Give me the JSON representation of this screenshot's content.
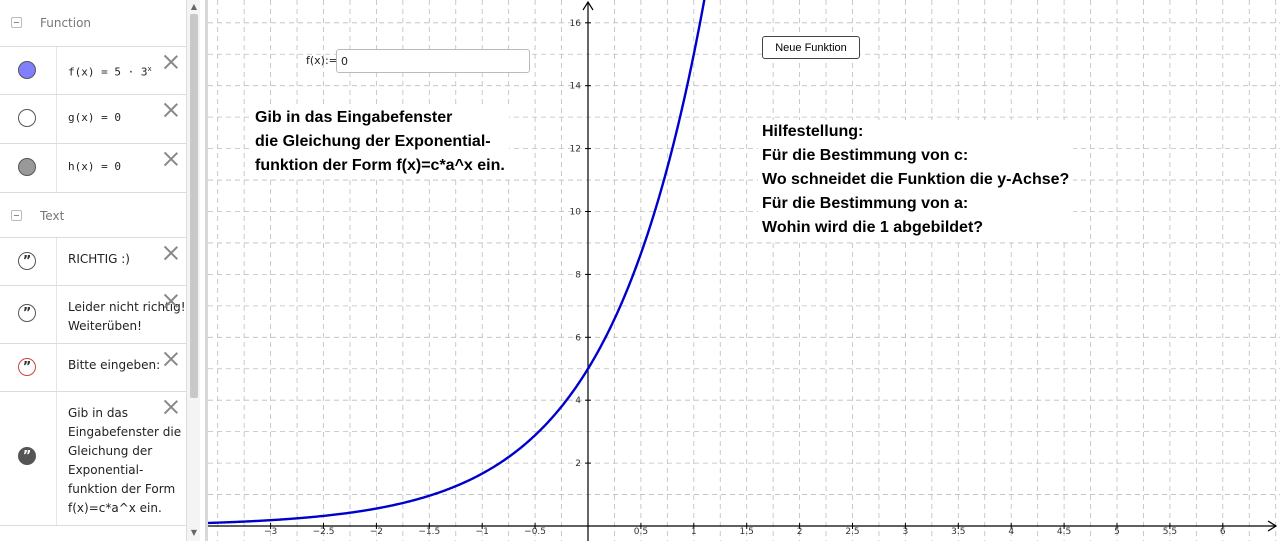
{
  "algebra": {
    "groups": [
      {
        "title": "Function"
      },
      {
        "title": "Text"
      }
    ],
    "functions": [
      {
        "name": "f(x)",
        "expr": "= 5 · 3",
        "exp": "x",
        "color": "#8080ff"
      },
      {
        "name": "g(x)",
        "expr": "= 0",
        "color": "#ffffff"
      },
      {
        "name": "h(x)",
        "expr": "= 0",
        "color": "#999999"
      }
    ],
    "texts": [
      {
        "lines": [
          "RICHTIG :)"
        ]
      },
      {
        "lines": [
          "Leider nicht richtig!",
          "Weiterüben!"
        ]
      },
      {
        "lines": [
          "Bitte eingeben:"
        ]
      },
      {
        "lines": [
          "Gib in das",
          "Eingabefenster die",
          "Gleichung der",
          "Exponential-",
          "funktion der Form",
          "f(x)=c*a^x ein."
        ]
      }
    ]
  },
  "input_box": {
    "label": "f(x):=",
    "value": "0"
  },
  "button": {
    "label": "Neue Funktion"
  },
  "instruction": {
    "lines": [
      "Gib in das Eingabefenster",
      "die Gleichung der Exponential-",
      "funktion der Form f(x)=c*a^x ein."
    ]
  },
  "hint": {
    "lines": [
      "Hilfestellung:",
      "Für die Bestimmung von c:",
      "Wo schneidet die Funktion die y-Achse?",
      "Für die Bestimmung von a:",
      "Wohin wird die 1 abgebildet?"
    ]
  },
  "chart_data": {
    "type": "line",
    "series": [
      {
        "name": "f(x) = 5 · 3^x",
        "c": 5,
        "a": 3,
        "color": "#0000cc"
      }
    ],
    "xlim": [
      -3.6,
      6.5
    ],
    "ylim": [
      0,
      16.5
    ],
    "x_ticks": [
      -3,
      -2.5,
      -2,
      -1.5,
      -1,
      -0.5,
      0.5,
      1,
      1.5,
      2,
      2.5,
      3,
      3.5,
      4,
      4.5,
      5,
      5.5,
      6
    ],
    "y_ticks": [
      2,
      4,
      6,
      8,
      10,
      12,
      14,
      16
    ],
    "grid": true
  }
}
